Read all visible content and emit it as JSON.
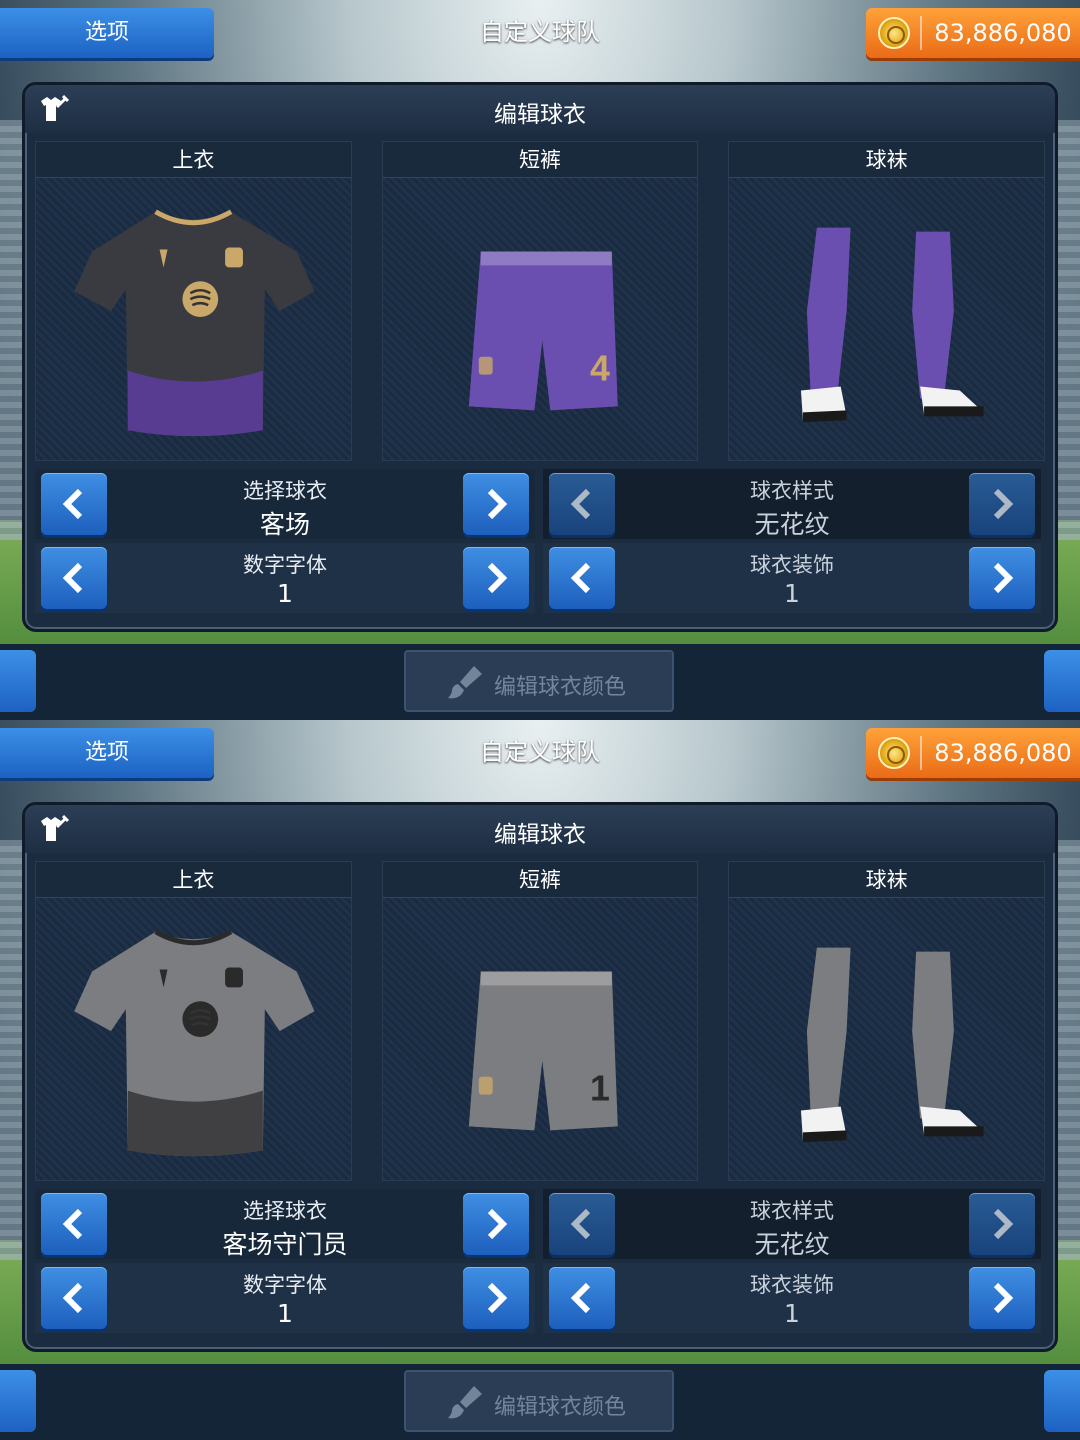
{
  "screens": [
    {
      "options_label": "选项",
      "title": "自定义球队",
      "coins": "83,886,080",
      "panel_title": "编辑球衣",
      "slots": [
        {
          "title": "上衣",
          "item": "shirt-icon"
        },
        {
          "title": "短裤",
          "item": "shorts-icon"
        },
        {
          "title": "球袜",
          "item": "socks-icon"
        }
      ],
      "kit_colors": {
        "main": "#3a3b40",
        "accent": "#5b3d9a",
        "trim": "#c9a86a",
        "shorts": "#6a4fb0",
        "socks": "#6a4fb0",
        "number": "4"
      },
      "controls": {
        "left": [
          {
            "label": "选择球衣",
            "value": "客场"
          },
          {
            "label": "数字字体",
            "value": "1"
          }
        ],
        "right": [
          {
            "label": "球衣样式",
            "value": "无花纹"
          },
          {
            "label": "球衣装饰",
            "value": "1"
          }
        ]
      },
      "edit_colors_label": "编辑球衣颜色"
    },
    {
      "options_label": "选项",
      "title": "自定义球队",
      "coins": "83,886,080",
      "panel_title": "编辑球衣",
      "slots": [
        {
          "title": "上衣",
          "item": "shirt-icon"
        },
        {
          "title": "短裤",
          "item": "shorts-icon"
        },
        {
          "title": "球袜",
          "item": "socks-icon"
        }
      ],
      "kit_colors": {
        "main": "#7c7d80",
        "accent": "#3a3a3c",
        "trim": "#2a2a2a",
        "shorts": "#7c7d80",
        "socks": "#7c7d80",
        "number": "1"
      },
      "controls": {
        "left": [
          {
            "label": "选择球衣",
            "value": "客场守门员"
          },
          {
            "label": "数字字体",
            "value": "1"
          }
        ],
        "right": [
          {
            "label": "球衣样式",
            "value": "无花纹"
          },
          {
            "label": "球衣装饰",
            "value": "1"
          }
        ]
      },
      "edit_colors_label": "编辑球衣颜色"
    }
  ]
}
